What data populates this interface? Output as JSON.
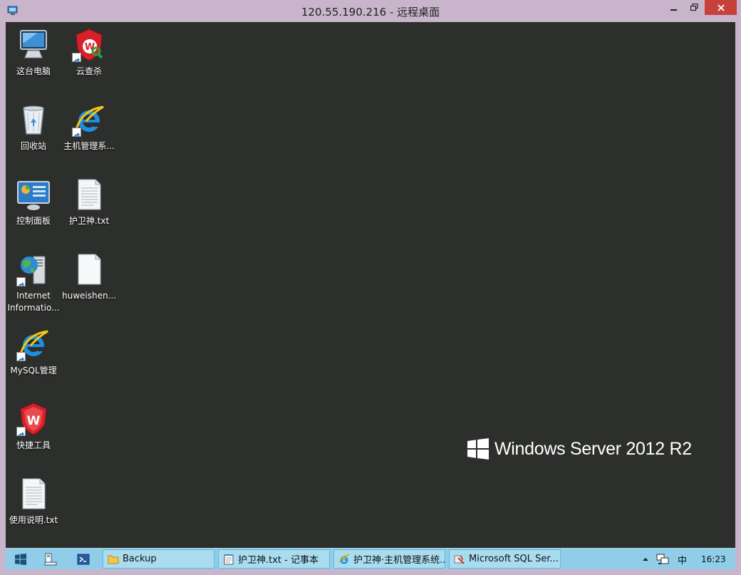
{
  "window": {
    "title": "120.55.190.216 - 远程桌面"
  },
  "desktop": {
    "icons": [
      {
        "label": "这台电脑",
        "icon": "computer-icon"
      },
      {
        "label": "云查杀",
        "icon": "shield-scan-icon"
      },
      {
        "label": "回收站",
        "icon": "recycle-bin-icon"
      },
      {
        "label": "主机管理系...",
        "icon": "internet-explorer-icon"
      },
      {
        "label": "控制面板",
        "icon": "control-panel-icon"
      },
      {
        "label": "护卫神.txt",
        "icon": "text-file-icon"
      },
      {
        "label": "Internet\nInformatio...",
        "icon": "iis-icon"
      },
      {
        "label": "huweishen...",
        "icon": "blank-file-icon"
      },
      {
        "label": "MySQL管理",
        "icon": "internet-explorer-icon"
      },
      {
        "label": "快捷工具",
        "icon": "shield-icon"
      },
      {
        "label": "使用说明.txt",
        "icon": "text-file-icon"
      }
    ],
    "brand": "Windows Server 2012 R2"
  },
  "taskbar": {
    "tasks": [
      {
        "label": "Backup",
        "icon": "folder-icon"
      },
      {
        "label": "护卫神.txt - 记事本",
        "icon": "notepad-icon"
      },
      {
        "label": "护卫神·主机管理系统...",
        "icon": "internet-explorer-icon"
      },
      {
        "label": "Microsoft SQL Ser...",
        "icon": "sql-server-icon"
      }
    ],
    "tray": {
      "ime": "中",
      "time": "16:23"
    }
  },
  "colors": {
    "desktop_bg": "#2d2f2c",
    "taskbar_bg": "#8fcde8",
    "window_frame": "#c8b5cb",
    "close_red": "#c7413b"
  }
}
